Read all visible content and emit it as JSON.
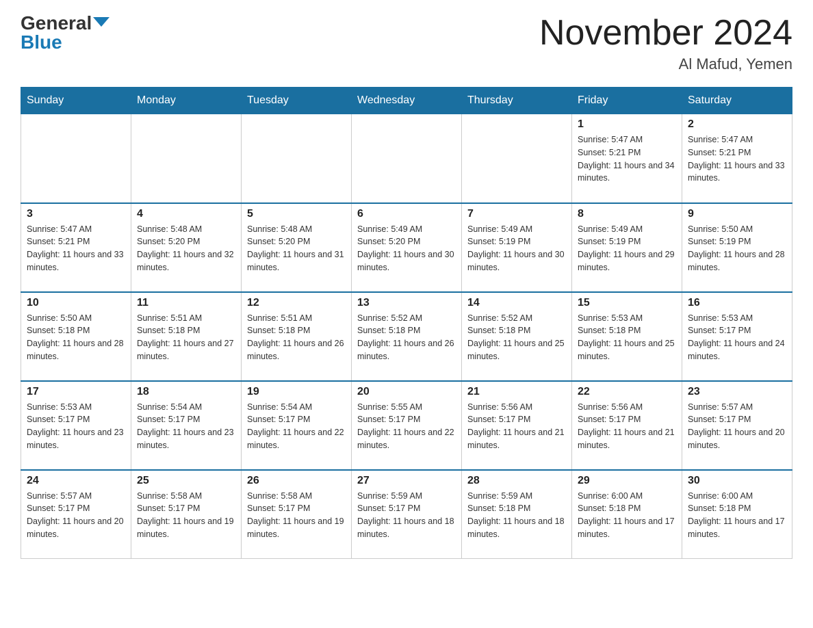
{
  "header": {
    "logo_general": "General",
    "logo_blue": "Blue",
    "month_title": "November 2024",
    "location": "Al Mafud, Yemen"
  },
  "days_of_week": [
    "Sunday",
    "Monday",
    "Tuesday",
    "Wednesday",
    "Thursday",
    "Friday",
    "Saturday"
  ],
  "weeks": [
    [
      {
        "day": "",
        "info": ""
      },
      {
        "day": "",
        "info": ""
      },
      {
        "day": "",
        "info": ""
      },
      {
        "day": "",
        "info": ""
      },
      {
        "day": "",
        "info": ""
      },
      {
        "day": "1",
        "info": "Sunrise: 5:47 AM\nSunset: 5:21 PM\nDaylight: 11 hours and 34 minutes."
      },
      {
        "day": "2",
        "info": "Sunrise: 5:47 AM\nSunset: 5:21 PM\nDaylight: 11 hours and 33 minutes."
      }
    ],
    [
      {
        "day": "3",
        "info": "Sunrise: 5:47 AM\nSunset: 5:21 PM\nDaylight: 11 hours and 33 minutes."
      },
      {
        "day": "4",
        "info": "Sunrise: 5:48 AM\nSunset: 5:20 PM\nDaylight: 11 hours and 32 minutes."
      },
      {
        "day": "5",
        "info": "Sunrise: 5:48 AM\nSunset: 5:20 PM\nDaylight: 11 hours and 31 minutes."
      },
      {
        "day": "6",
        "info": "Sunrise: 5:49 AM\nSunset: 5:20 PM\nDaylight: 11 hours and 30 minutes."
      },
      {
        "day": "7",
        "info": "Sunrise: 5:49 AM\nSunset: 5:19 PM\nDaylight: 11 hours and 30 minutes."
      },
      {
        "day": "8",
        "info": "Sunrise: 5:49 AM\nSunset: 5:19 PM\nDaylight: 11 hours and 29 minutes."
      },
      {
        "day": "9",
        "info": "Sunrise: 5:50 AM\nSunset: 5:19 PM\nDaylight: 11 hours and 28 minutes."
      }
    ],
    [
      {
        "day": "10",
        "info": "Sunrise: 5:50 AM\nSunset: 5:18 PM\nDaylight: 11 hours and 28 minutes."
      },
      {
        "day": "11",
        "info": "Sunrise: 5:51 AM\nSunset: 5:18 PM\nDaylight: 11 hours and 27 minutes."
      },
      {
        "day": "12",
        "info": "Sunrise: 5:51 AM\nSunset: 5:18 PM\nDaylight: 11 hours and 26 minutes."
      },
      {
        "day": "13",
        "info": "Sunrise: 5:52 AM\nSunset: 5:18 PM\nDaylight: 11 hours and 26 minutes."
      },
      {
        "day": "14",
        "info": "Sunrise: 5:52 AM\nSunset: 5:18 PM\nDaylight: 11 hours and 25 minutes."
      },
      {
        "day": "15",
        "info": "Sunrise: 5:53 AM\nSunset: 5:18 PM\nDaylight: 11 hours and 25 minutes."
      },
      {
        "day": "16",
        "info": "Sunrise: 5:53 AM\nSunset: 5:17 PM\nDaylight: 11 hours and 24 minutes."
      }
    ],
    [
      {
        "day": "17",
        "info": "Sunrise: 5:53 AM\nSunset: 5:17 PM\nDaylight: 11 hours and 23 minutes."
      },
      {
        "day": "18",
        "info": "Sunrise: 5:54 AM\nSunset: 5:17 PM\nDaylight: 11 hours and 23 minutes."
      },
      {
        "day": "19",
        "info": "Sunrise: 5:54 AM\nSunset: 5:17 PM\nDaylight: 11 hours and 22 minutes."
      },
      {
        "day": "20",
        "info": "Sunrise: 5:55 AM\nSunset: 5:17 PM\nDaylight: 11 hours and 22 minutes."
      },
      {
        "day": "21",
        "info": "Sunrise: 5:56 AM\nSunset: 5:17 PM\nDaylight: 11 hours and 21 minutes."
      },
      {
        "day": "22",
        "info": "Sunrise: 5:56 AM\nSunset: 5:17 PM\nDaylight: 11 hours and 21 minutes."
      },
      {
        "day": "23",
        "info": "Sunrise: 5:57 AM\nSunset: 5:17 PM\nDaylight: 11 hours and 20 minutes."
      }
    ],
    [
      {
        "day": "24",
        "info": "Sunrise: 5:57 AM\nSunset: 5:17 PM\nDaylight: 11 hours and 20 minutes."
      },
      {
        "day": "25",
        "info": "Sunrise: 5:58 AM\nSunset: 5:17 PM\nDaylight: 11 hours and 19 minutes."
      },
      {
        "day": "26",
        "info": "Sunrise: 5:58 AM\nSunset: 5:17 PM\nDaylight: 11 hours and 19 minutes."
      },
      {
        "day": "27",
        "info": "Sunrise: 5:59 AM\nSunset: 5:17 PM\nDaylight: 11 hours and 18 minutes."
      },
      {
        "day": "28",
        "info": "Sunrise: 5:59 AM\nSunset: 5:18 PM\nDaylight: 11 hours and 18 minutes."
      },
      {
        "day": "29",
        "info": "Sunrise: 6:00 AM\nSunset: 5:18 PM\nDaylight: 11 hours and 17 minutes."
      },
      {
        "day": "30",
        "info": "Sunrise: 6:00 AM\nSunset: 5:18 PM\nDaylight: 11 hours and 17 minutes."
      }
    ]
  ]
}
